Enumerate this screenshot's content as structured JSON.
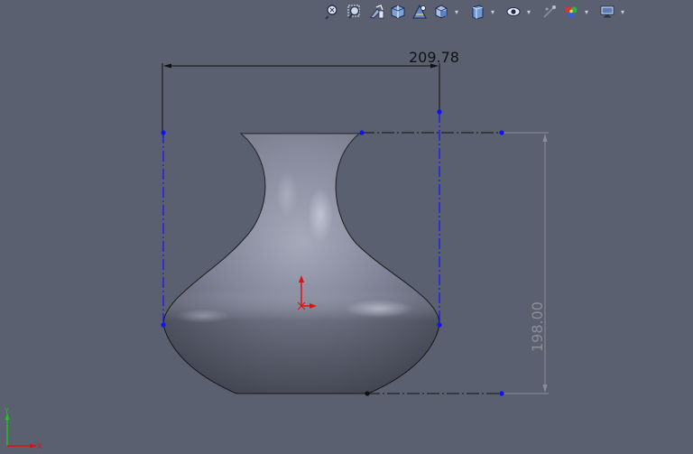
{
  "toolbar": {
    "icons": [
      "zoom-to-fit-icon",
      "zoom-to-area-icon",
      "previous-view-icon",
      "section-view-icon",
      "dynamic-annotation-view-icon",
      "view-orientation-icon",
      "display-style-icon",
      "hide-show-items-icon",
      "edit-appearance-icon",
      "apply-scene-icon",
      "view-settings-icon"
    ]
  },
  "sketch": {
    "width_dimension": "209.78",
    "height_dimension": "198.00"
  },
  "triad": {
    "x_label": "X",
    "y_label": "Y"
  },
  "colors": {
    "background": "#5b6070",
    "sketch_blue": "#1010ff",
    "dimension_gray": "#8a8e96",
    "origin_red": "#e01010"
  }
}
